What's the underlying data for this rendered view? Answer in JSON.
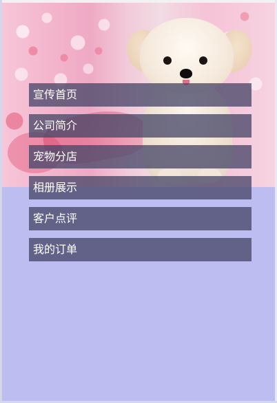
{
  "hero": {
    "image_subject": "puppy-on-floral-background"
  },
  "menu": {
    "items": [
      {
        "label": "宣传首页"
      },
      {
        "label": "公司简介"
      },
      {
        "label": "宠物分店"
      },
      {
        "label": "相册展示"
      },
      {
        "label": "客户点评"
      },
      {
        "label": "我的订单"
      }
    ]
  },
  "colors": {
    "page_background": "#bdbdf1",
    "menu_item_background": "#464666",
    "menu_text": "#ffffff"
  }
}
